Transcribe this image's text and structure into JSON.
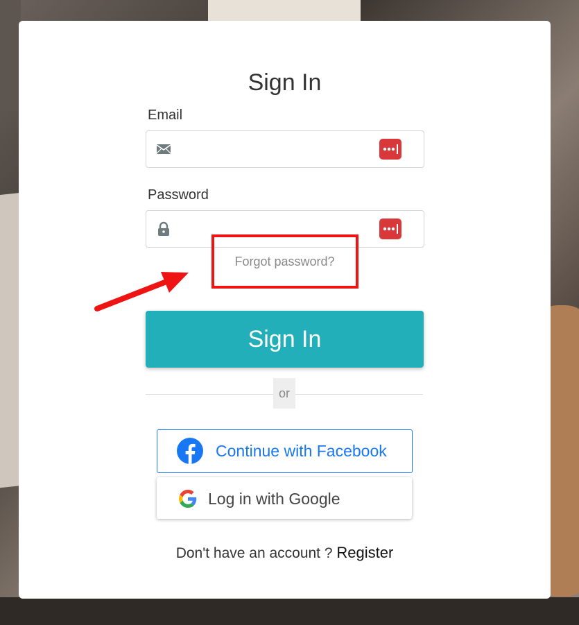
{
  "page": {
    "title": "Sign In",
    "email_label": "Email",
    "email_value": "",
    "password_label": "Password",
    "password_value": "",
    "forgot_link": "Forgot password?",
    "signin_button": "Sign In",
    "divider_text": "or",
    "facebook_button": "Continue with Facebook",
    "google_button": "Log in with Google",
    "register_prompt": "Don't have an account ?",
    "register_link": "Register"
  },
  "icons": {
    "email": "envelope-icon",
    "password": "lock-icon",
    "password_manager": "lastpass-icon",
    "facebook": "facebook-logo-icon",
    "google": "google-logo-icon"
  },
  "colors": {
    "accent": "#22afb9",
    "facebook": "#1877f2",
    "annotation": "#ee1414",
    "password_manager": "#d9383b"
  }
}
